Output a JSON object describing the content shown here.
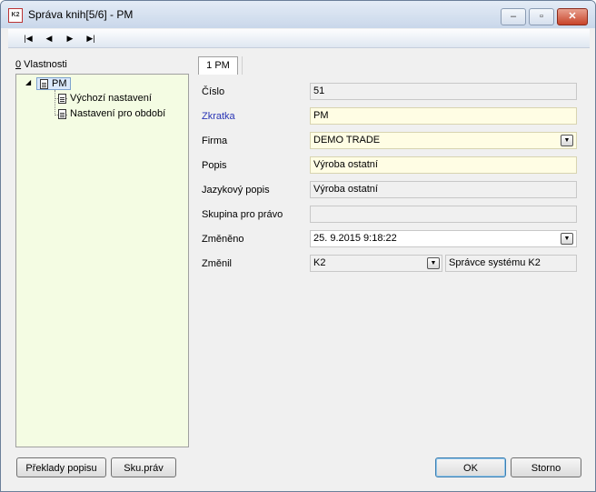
{
  "window": {
    "title": "Správa knih[5/6] - PM",
    "app_icon_text": "K2",
    "controls": {
      "minimize": "–",
      "maximize": "▫",
      "close": "✕"
    }
  },
  "navbar": {
    "first": "|◀",
    "prev": "◀",
    "next": "▶",
    "last": "▶|"
  },
  "tree": {
    "label_hotkey": "0",
    "label": " Vlastnosti",
    "expander": "◢",
    "root": "PM",
    "children": [
      "Výchozí nastavení",
      "Nastavení pro období"
    ]
  },
  "tab": {
    "label": "1 PM"
  },
  "form": {
    "cislo": {
      "label": "Číslo",
      "value": "51"
    },
    "zkratka": {
      "label": "Zkratka",
      "value": "PM"
    },
    "firma": {
      "label": "Firma",
      "value": "DEMO TRADE"
    },
    "popis": {
      "label": "Popis",
      "value": "Výroba ostatní"
    },
    "jazykovy_popis": {
      "label": "Jazykový popis",
      "value": "Výroba ostatní"
    },
    "skupina": {
      "label": "Skupina pro právo",
      "value": ""
    },
    "zmeneno": {
      "label": "Změněno",
      "value": "25. 9.2015  9:18:22"
    },
    "zmenil": {
      "label": "Změnil",
      "value": "K2",
      "name": "Správce systému K2"
    }
  },
  "dropdown_glyph": "▼",
  "buttons": {
    "preklady": "Překlady popisu",
    "sku_prav": "Sku.práv",
    "ok": "OK",
    "storno": "Storno"
  }
}
